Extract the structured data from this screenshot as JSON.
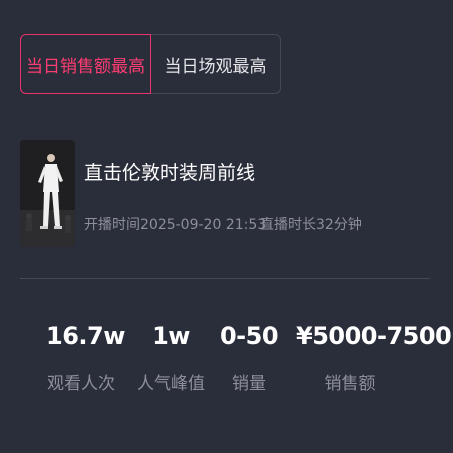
{
  "tabs": [
    {
      "label": "当日销售额最高",
      "active": true
    },
    {
      "label": "当日场观最高",
      "active": false
    }
  ],
  "live": {
    "title": "直击伦敦时装周前线",
    "start_time": "开播时间2025-09-20 21:53",
    "duration": "直播时长32分钟"
  },
  "stats": [
    {
      "value": "16.7w",
      "label": "观看人次"
    },
    {
      "value": "1w",
      "label": "人气峰值"
    },
    {
      "value": "0-50",
      "label": "销量"
    },
    {
      "value": "¥5000-7500",
      "label": "销售额"
    }
  ],
  "colors": {
    "background": "#2a2d3a",
    "accent": "#ff3d73",
    "muted_text": "#8d909c",
    "divider": "#444857"
  }
}
